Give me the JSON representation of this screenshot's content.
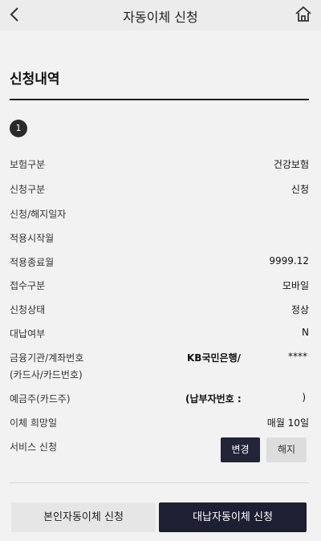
{
  "header": {
    "title": "자동이체 신청",
    "back_icon": "chevron-left-icon",
    "home_icon": "home-icon"
  },
  "section": {
    "title": "신청내역",
    "index": "1"
  },
  "details": [
    {
      "label": "보험구분",
      "value": "건강보험"
    },
    {
      "label": "신청구분",
      "value": "신청"
    },
    {
      "label": "신청/해지일자",
      "value": ""
    },
    {
      "label": "적용시작월",
      "value": ""
    },
    {
      "label": "적용종료월",
      "value": "9999.12"
    },
    {
      "label": "접수구분",
      "value": "모바일"
    },
    {
      "label": "신청상태",
      "value": "정상"
    },
    {
      "label": "대납여부",
      "value": "N"
    }
  ],
  "account": {
    "label_line1": "금융기관/계좌번호",
    "label_line2": "(카드사/카드번호)",
    "bank_name": "KB국민은행/",
    "masked_number": "****"
  },
  "payer": {
    "label": "예금주(카드주)",
    "value_open": "(납부자번호 :",
    "value_close": ")"
  },
  "transfer_day": {
    "label": "이체 희망일",
    "value": "매월 10일"
  },
  "service": {
    "label": "서비스 신청",
    "change_button": "변경",
    "cancel_button": "해지"
  },
  "footer": {
    "self_button": "본인자동이체 신청",
    "proxy_button": "대납자동이체 신청"
  },
  "colors": {
    "header_bg": "#ececec",
    "body_bg": "#f2f2f2",
    "primary_dark": "#1f1f33",
    "secondary_light": "#e6e6e6"
  }
}
